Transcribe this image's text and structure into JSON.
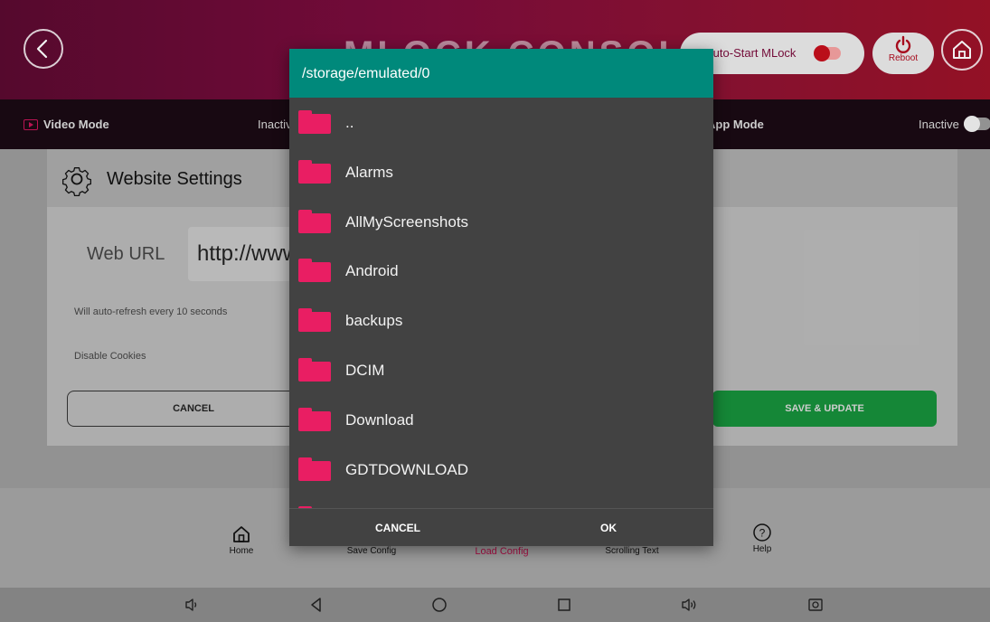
{
  "header": {
    "brand": "MLOCK CONSOLE",
    "autostart_label": "Auto-Start MLock",
    "reboot_label": "Reboot"
  },
  "modebar": {
    "video_mode_label": "Video Mode",
    "video_mode_status": "Inactive",
    "app_mode_label": "App Mode",
    "app_mode_status": "Inactive"
  },
  "settings": {
    "title": "Website Settings",
    "url_label": "Web URL",
    "url_value": "http://www",
    "refresh_text": "Will auto-refresh every 10 seconds",
    "cookies_text": "Disable Cookies",
    "cancel_label": "CANCEL",
    "save_label": "SAVE & UPDATE"
  },
  "bottom_nav": {
    "home": "Home",
    "save_config": "Save Config",
    "load_config": "Load Config",
    "scrolling_text": "Scrolling Text",
    "help": "Help"
  },
  "dialog": {
    "path": "/storage/emulated/0",
    "items": [
      "..",
      "Alarms",
      "AllMyScreenshots",
      "Android",
      "backups",
      "DCIM",
      "Download",
      "GDTDOWNLOAD"
    ],
    "cancel_label": "CANCEL",
    "ok_label": "OK"
  },
  "colors": {
    "accent_folder": "#e91e63",
    "dialog_header": "#00897b",
    "header_brand": "#7a0c3c",
    "save_button": "#178f3a"
  }
}
